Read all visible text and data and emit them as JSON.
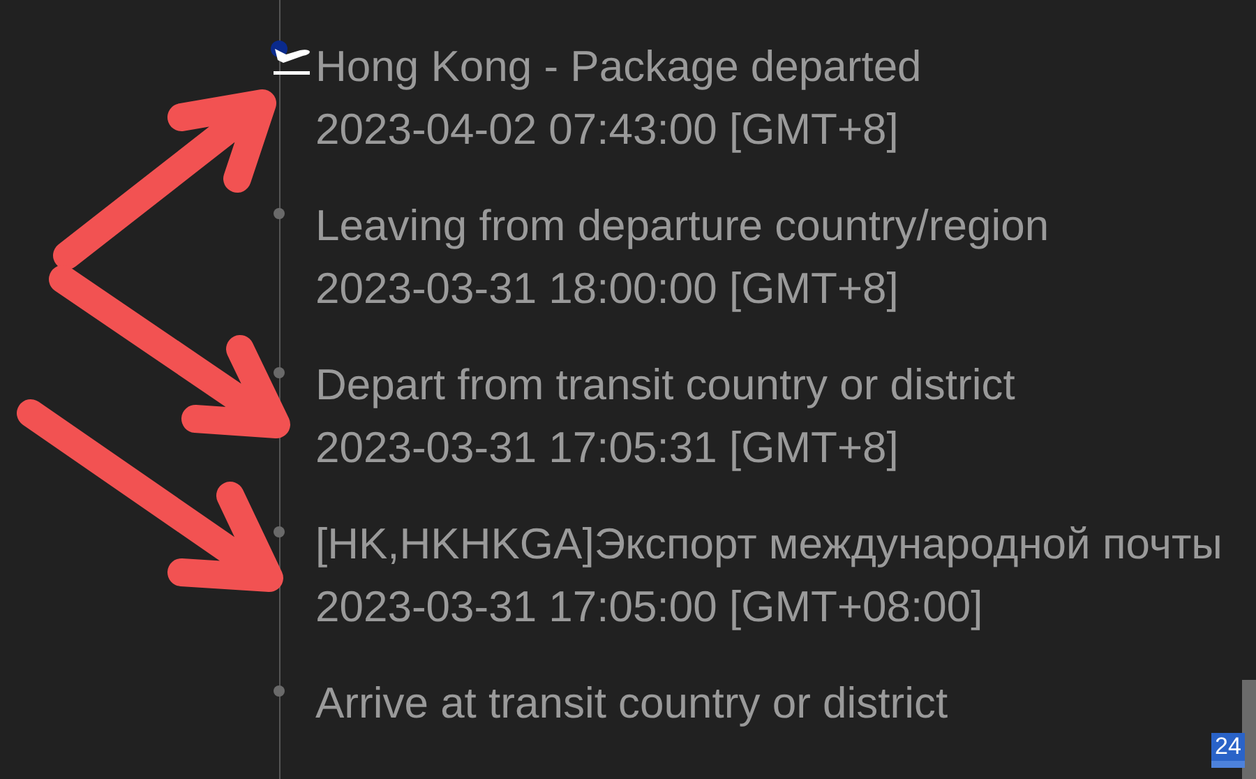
{
  "events": [
    {
      "title": "Hong Kong - Package departed",
      "time": "2023-04-02 07:43:00 [GMT+8]",
      "current": true
    },
    {
      "title": "Leaving from departure country/region",
      "time": "2023-03-31 18:00:00 [GMT+8]",
      "current": false
    },
    {
      "title": "Depart from transit country or district",
      "time": "2023-03-31 17:05:31 [GMT+8]",
      "current": false
    },
    {
      "title": "[HK,HKHKGA]Экспорт международной почты",
      "time": "2023-03-31 17:05:00 [GMT+08:00]",
      "current": false
    },
    {
      "title": "Arrive at transit country or district",
      "current": false
    }
  ],
  "badge": "24"
}
